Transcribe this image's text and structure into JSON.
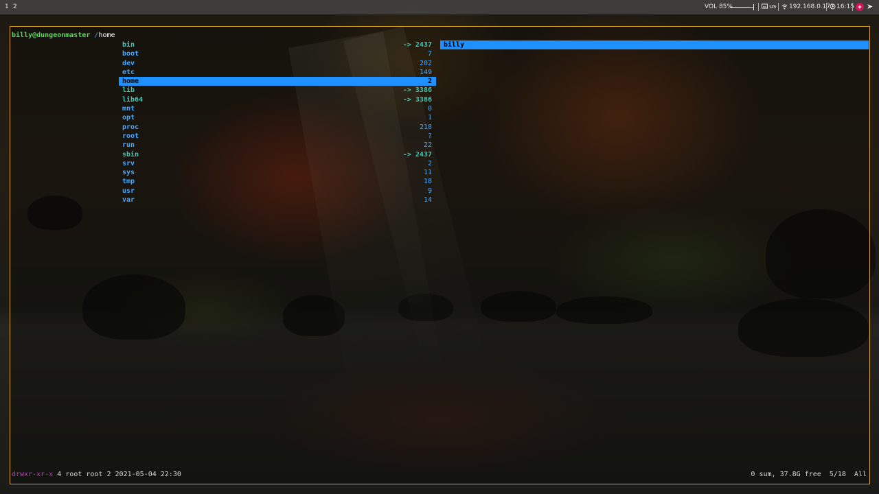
{
  "topbar": {
    "workspaces": [
      "1",
      "2"
    ],
    "volume_label": "VOL 85%",
    "volume_level": 0.85,
    "keyboard_icon": "keyboard-icon",
    "keyboard_layout": "us",
    "network_icon": "network-icon",
    "ip_address": "192.168.0.177",
    "clock_icon": "clock-icon",
    "time": "16:15"
  },
  "terminal": {
    "prompt_user": "billy@dungeonmaster",
    "prompt_slash": " /",
    "current_dir": "home",
    "entries": [
      {
        "name": "bin",
        "size": "-> 2437",
        "link": true
      },
      {
        "name": "boot",
        "size": "7",
        "link": false
      },
      {
        "name": "dev",
        "size": "202",
        "link": false
      },
      {
        "name": "etc",
        "size": "149",
        "link": false
      },
      {
        "name": "home",
        "size": "2",
        "link": false
      },
      {
        "name": "lib",
        "size": "-> 3386",
        "link": true
      },
      {
        "name": "lib64",
        "size": "-> 3386",
        "link": true
      },
      {
        "name": "mnt",
        "size": "0",
        "link": false
      },
      {
        "name": "opt",
        "size": "1",
        "link": false
      },
      {
        "name": "proc",
        "size": "218",
        "link": false
      },
      {
        "name": "root",
        "size": "?",
        "link": false
      },
      {
        "name": "run",
        "size": "22",
        "link": false
      },
      {
        "name": "sbin",
        "size": "-> 2437",
        "link": true
      },
      {
        "name": "srv",
        "size": "2",
        "link": false
      },
      {
        "name": "sys",
        "size": "11",
        "link": false
      },
      {
        "name": "tmp",
        "size": "18",
        "link": false
      },
      {
        "name": "usr",
        "size": "9",
        "link": false
      },
      {
        "name": "var",
        "size": "14",
        "link": false
      }
    ],
    "selected_index": 4,
    "preview_entries": [
      "billy"
    ],
    "status_permissions": "drwxr-xr-x",
    "status_details": " 4 root root 2 2021-05-04 22:30",
    "status_summary": "0 sum, 37.8G free  5/18  All"
  },
  "colors": {
    "border": "#e0a430",
    "selection": "#1e90ff",
    "directory": "#46a7ff",
    "symlink": "#3cc8b8",
    "user": "#5fd75f",
    "permissions": "#c03cc0"
  }
}
